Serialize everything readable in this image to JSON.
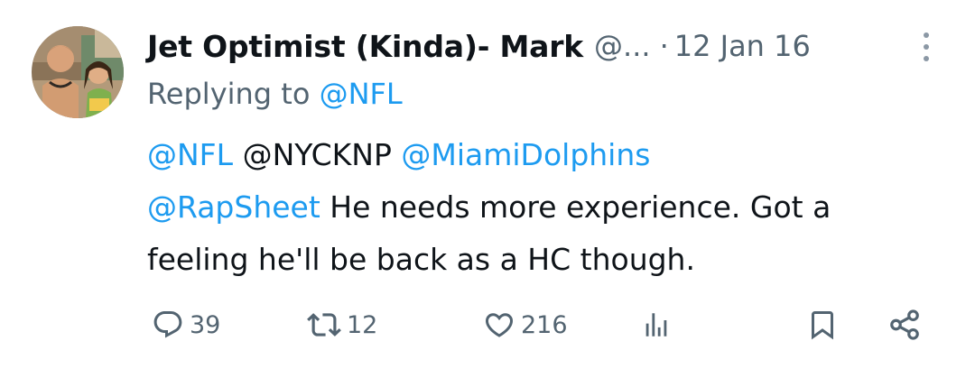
{
  "tweet": {
    "author_name": "Jet Optimist (Kinda)- Mark",
    "author_handle": "@...",
    "separator": "·",
    "timestamp": "12 Jan 16",
    "replying_prefix": "Replying to",
    "replying_to": "@NFL",
    "body_lines": {
      "line1": {
        "m1": "@NFL",
        "m2": "@NYCKNP",
        "m3": "@MiamiDolphins"
      },
      "line2": {
        "m1": "@RapSheet",
        "text": "He needs more experience. Got a"
      },
      "line3": {
        "text": "feeling he'll be back as a HC though."
      }
    }
  },
  "actions": {
    "replies": "39",
    "retweets": "12",
    "likes": "216"
  },
  "icons": {
    "reply": "reply-icon",
    "retweet": "retweet-icon",
    "like": "heart-icon",
    "views": "analytics-icon",
    "bookmark": "bookmark-icon",
    "share": "share-icon",
    "more": "more-icon"
  },
  "colors": {
    "text": "#0f1419",
    "secondary": "#536471",
    "link": "#1d9bf0"
  }
}
